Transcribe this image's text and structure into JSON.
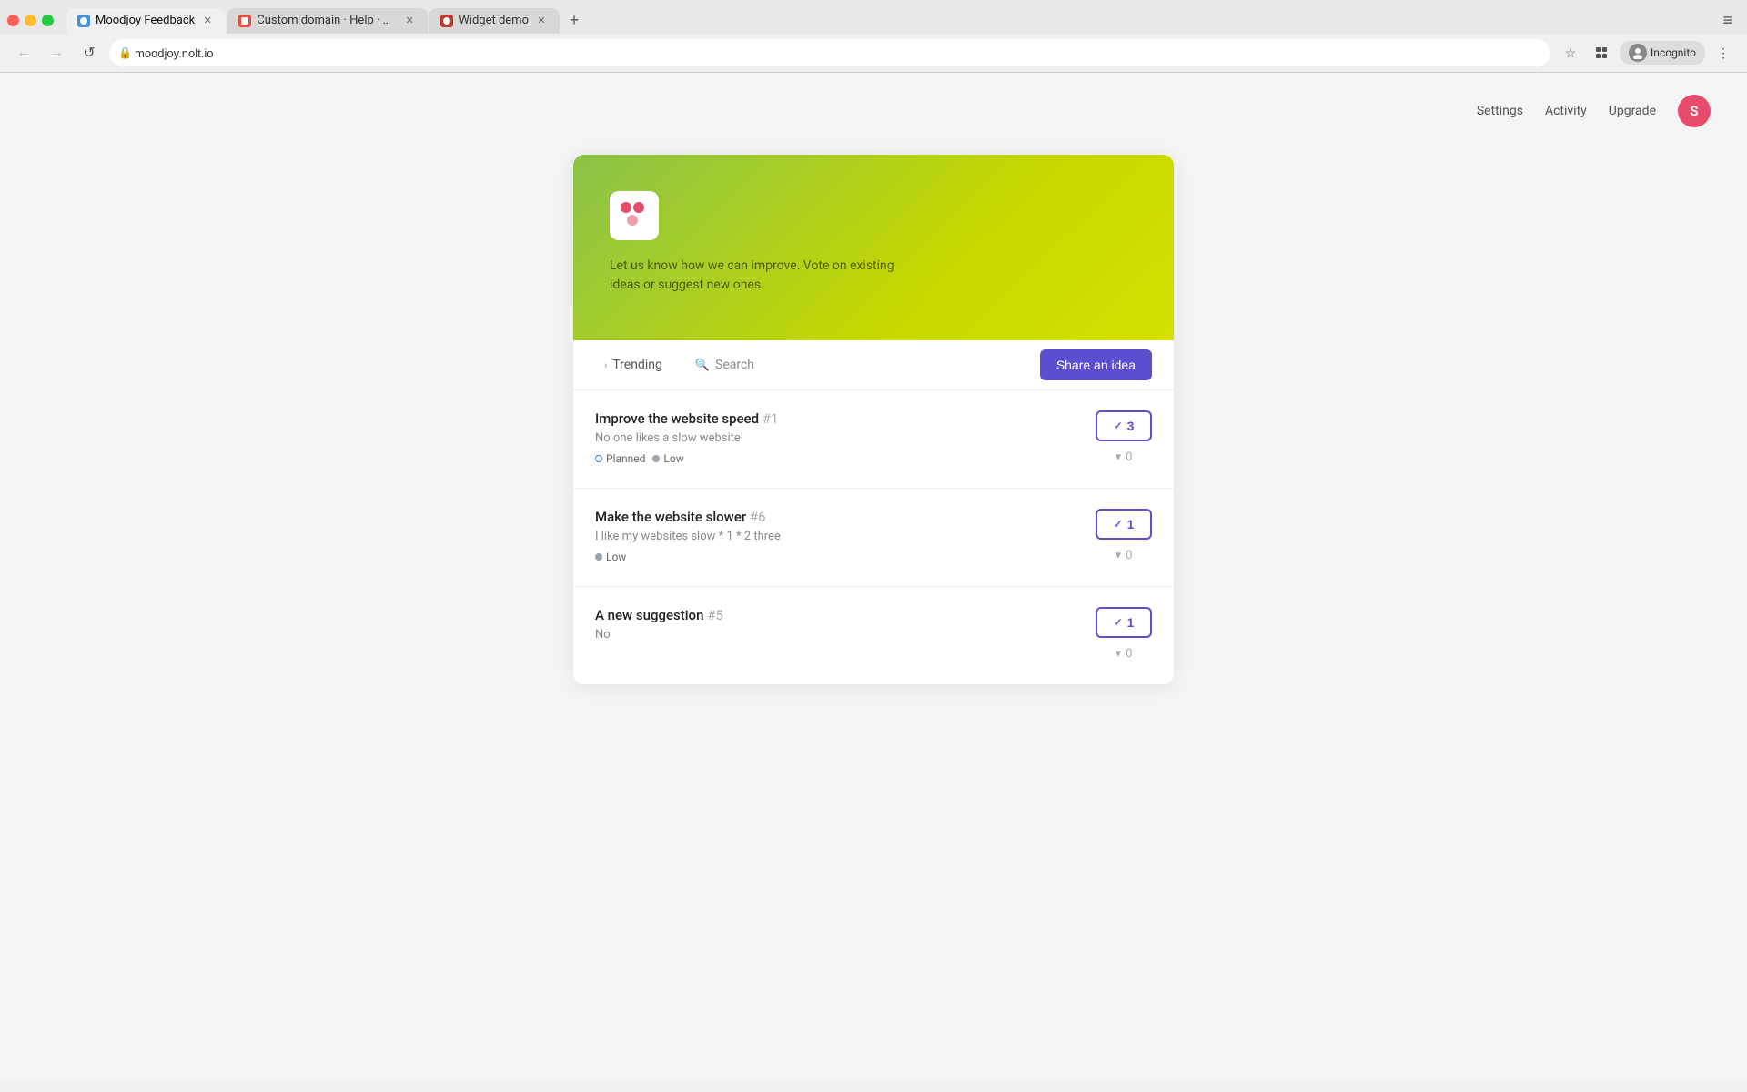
{
  "browser": {
    "tabs": [
      {
        "id": "tab1",
        "label": "Moodjoy Feedback",
        "url": "moodjoy.nolt.io",
        "favicon_color": "#4a90d9",
        "active": true
      },
      {
        "id": "tab2",
        "label": "Custom domain · Help · Nolt",
        "url": "help.nolt.io",
        "favicon_color": "#e74c3c",
        "active": false
      },
      {
        "id": "tab3",
        "label": "Widget demo",
        "url": "widget.nolt.io",
        "favicon_color": "#c0392b",
        "active": false
      }
    ],
    "url": "moodjoy.nolt.io",
    "incognito_label": "Incognito"
  },
  "nav": {
    "settings_label": "Settings",
    "activity_label": "Activity",
    "upgrade_label": "Upgrade",
    "avatar_initial": "S",
    "avatar_color": "#e74c6b"
  },
  "hero": {
    "description": "Let us know how we can improve. Vote on existing ideas or suggest new ones."
  },
  "toolbar": {
    "trending_label": "Trending",
    "search_label": "Search",
    "share_idea_label": "Share an idea"
  },
  "ideas": [
    {
      "id": "idea1",
      "title": "Improve the website speed",
      "number": "#1",
      "description": "No one likes a slow website!",
      "tags": [
        {
          "label": "Planned",
          "type": "planned"
        },
        {
          "label": "Low",
          "type": "low"
        }
      ],
      "votes_up": 3,
      "votes_down": 0
    },
    {
      "id": "idea2",
      "title": "Make the website slower",
      "number": "#6",
      "description": "I like my websites slow * 1 * 2 three",
      "tags": [
        {
          "label": "Low",
          "type": "low"
        }
      ],
      "votes_up": 1,
      "votes_down": 0
    },
    {
      "id": "idea3",
      "title": "A new suggestion",
      "number": "#5",
      "description": "No",
      "tags": [],
      "votes_up": 1,
      "votes_down": 0
    }
  ],
  "icons": {
    "close": "✕",
    "chevron_right": "›",
    "search": "🔍",
    "check": "✓",
    "arrow_down": "▾",
    "back": "←",
    "forward": "→",
    "reload": "↺",
    "star": "☆",
    "menu": "⋮",
    "lock": "🔒"
  }
}
